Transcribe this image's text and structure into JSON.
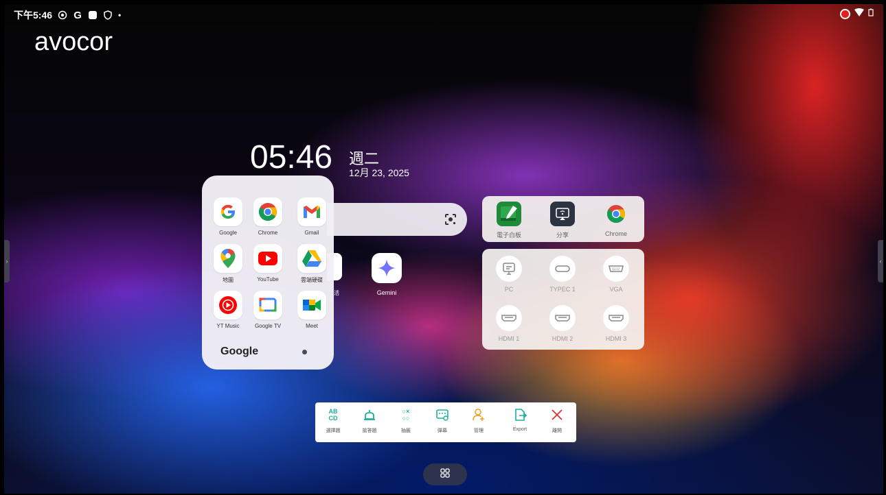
{
  "status_bar": {
    "time": "下午5:46",
    "g_icon": "G",
    "dot": "•",
    "icons_left": [
      "cast-icon",
      "google-icon",
      "square-icon",
      "shield-icon"
    ],
    "icons_right": [
      "screen-record-icon",
      "wifi-icon",
      "battery-icon"
    ],
    "accent_record": "#e02020"
  },
  "brand": {
    "logo": "avocor"
  },
  "clock": {
    "time": "05:46",
    "weekday": "週二",
    "date": "12月 23, 2025"
  },
  "home_apps": {
    "partial_label": "活",
    "gemini_label": "Gemini"
  },
  "google_folder": {
    "title": "Google",
    "apps": [
      {
        "label": "Google",
        "icon": "google-icon"
      },
      {
        "label": "Chrome",
        "icon": "chrome-icon"
      },
      {
        "label": "Gmail",
        "icon": "gmail-icon"
      },
      {
        "label": "地圖",
        "icon": "maps-icon"
      },
      {
        "label": "YouTube",
        "icon": "youtube-icon"
      },
      {
        "label": "雲端硬碟",
        "icon": "drive-icon"
      },
      {
        "label": "YT Music",
        "icon": "yt-music-icon"
      },
      {
        "label": "Google TV",
        "icon": "google-tv-icon"
      },
      {
        "label": "Meet",
        "icon": "meet-icon"
      }
    ]
  },
  "quick_apps": [
    {
      "label": "電子白板",
      "icon": "whiteboard-icon"
    },
    {
      "label": "分享",
      "icon": "screen-share-icon"
    },
    {
      "label": "Chrome",
      "icon": "chrome-icon"
    }
  ],
  "sources": [
    {
      "label": "PC",
      "icon": "monitor-icon"
    },
    {
      "label": "TYPEC 1",
      "icon": "usb-c-icon"
    },
    {
      "label": "VGA",
      "icon": "vga-icon"
    },
    {
      "label": "HDMI 1",
      "icon": "hdmi-icon"
    },
    {
      "label": "HDMI 2",
      "icon": "hdmi-icon"
    },
    {
      "label": "HDMI 3",
      "icon": "hdmi-icon"
    }
  ],
  "toolbar": {
    "items": [
      {
        "label": "選擇題",
        "icon": "abcd-icon",
        "glyph": "AB\nCD",
        "color": "#1ab0a0"
      },
      {
        "label": "搶答題",
        "icon": "buzzer-icon",
        "glyph": "⏏",
        "color": "#1ab0a0"
      },
      {
        "label": "抽籤",
        "icon": "random-icon",
        "glyph": "○×\n○○",
        "color": "#1ab0a0"
      },
      {
        "label": "彈幕",
        "icon": "bullet-comment-icon",
        "glyph": "▣",
        "color": "#1ab0a0"
      },
      {
        "label": "管理",
        "icon": "add-user-icon",
        "glyph": "♙",
        "color": "#f0a020"
      },
      {
        "label": "Export",
        "icon": "export-icon",
        "glyph": "⇲",
        "color": "#1ab0a0"
      },
      {
        "label": "離開",
        "icon": "close-icon",
        "glyph": "✕",
        "color": "#e03030"
      }
    ]
  },
  "drawer_glyph": "⊞",
  "edge_left": "›",
  "edge_right": "‹"
}
